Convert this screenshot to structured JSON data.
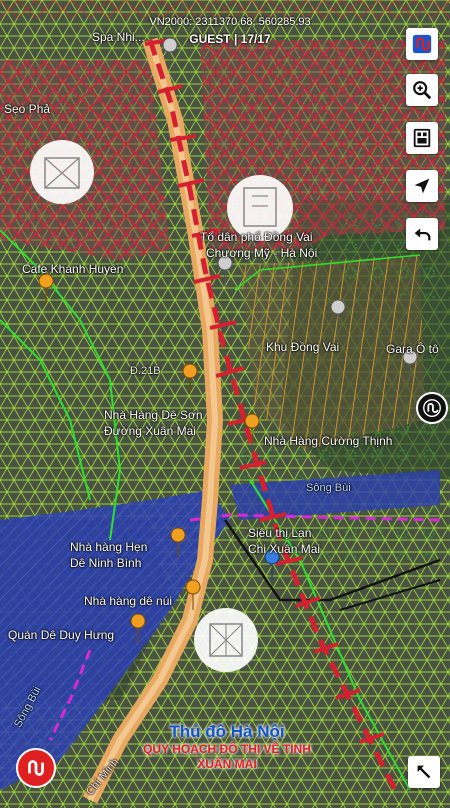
{
  "status": {
    "coords": "VN2000: 2311370.68, 560285.93",
    "session": "GUEST | 17/17"
  },
  "buttons": {
    "logo": "app-logo-icon",
    "zoom": "zoom-in-icon",
    "layers": "layers-icon",
    "locate": "locate-icon",
    "back": "back-icon",
    "compass": "compass-icon",
    "expand": "expand-icon"
  },
  "brand": {
    "title": "Thủ đô Hà Nội",
    "subtitle1": "QUY HOẠCH ĐÔ THỊ VỆ TINH",
    "subtitle2": "XUÂN MAI"
  },
  "labels": {
    "spa": "Spa Nhi...",
    "seo_pha": "Sẹo Phả",
    "cafe": "Cafe Khánh Huyền",
    "to_dan_pho": "Tổ dân phố Đồng Vai",
    "chuong_my": "Chương Mỹ - Hà Nội",
    "khu_dong_vai": "Khu Đồng Vai",
    "gara": "Gara Ô tô",
    "road_216": "Đ.21B",
    "nha_hang_de_son_1": "Nhà Hàng Dê Sơn",
    "nha_hang_de_son_2": "Đường Xuân Mai",
    "nha_hang_cuong_thinh": "Nhà Hàng Cường Thịnh",
    "song_bui_1": "Sông Bùi",
    "sieu_thi_1": "Siêu thị Lan",
    "sieu_thi_2": "Chi Xuân Mai",
    "nha_hang_hen_1": "Nhà hàng Hẹn",
    "nha_hang_hen_2": "Dê Ninh Bình",
    "nha_hang_de_nui": "Nhà hàng dê núi",
    "quan_de": "Quán Dê Duy Hưng",
    "song_bui_2": "Sông Bùi",
    "chi_minh": "Chí Minh"
  },
  "colors": {
    "red_hatch": "#d4203a",
    "green_grid": "#9cd23a",
    "orange_lines": "#e8a030",
    "river": "#2a3fb0",
    "road": "#e9a860",
    "route": "#d42030"
  }
}
